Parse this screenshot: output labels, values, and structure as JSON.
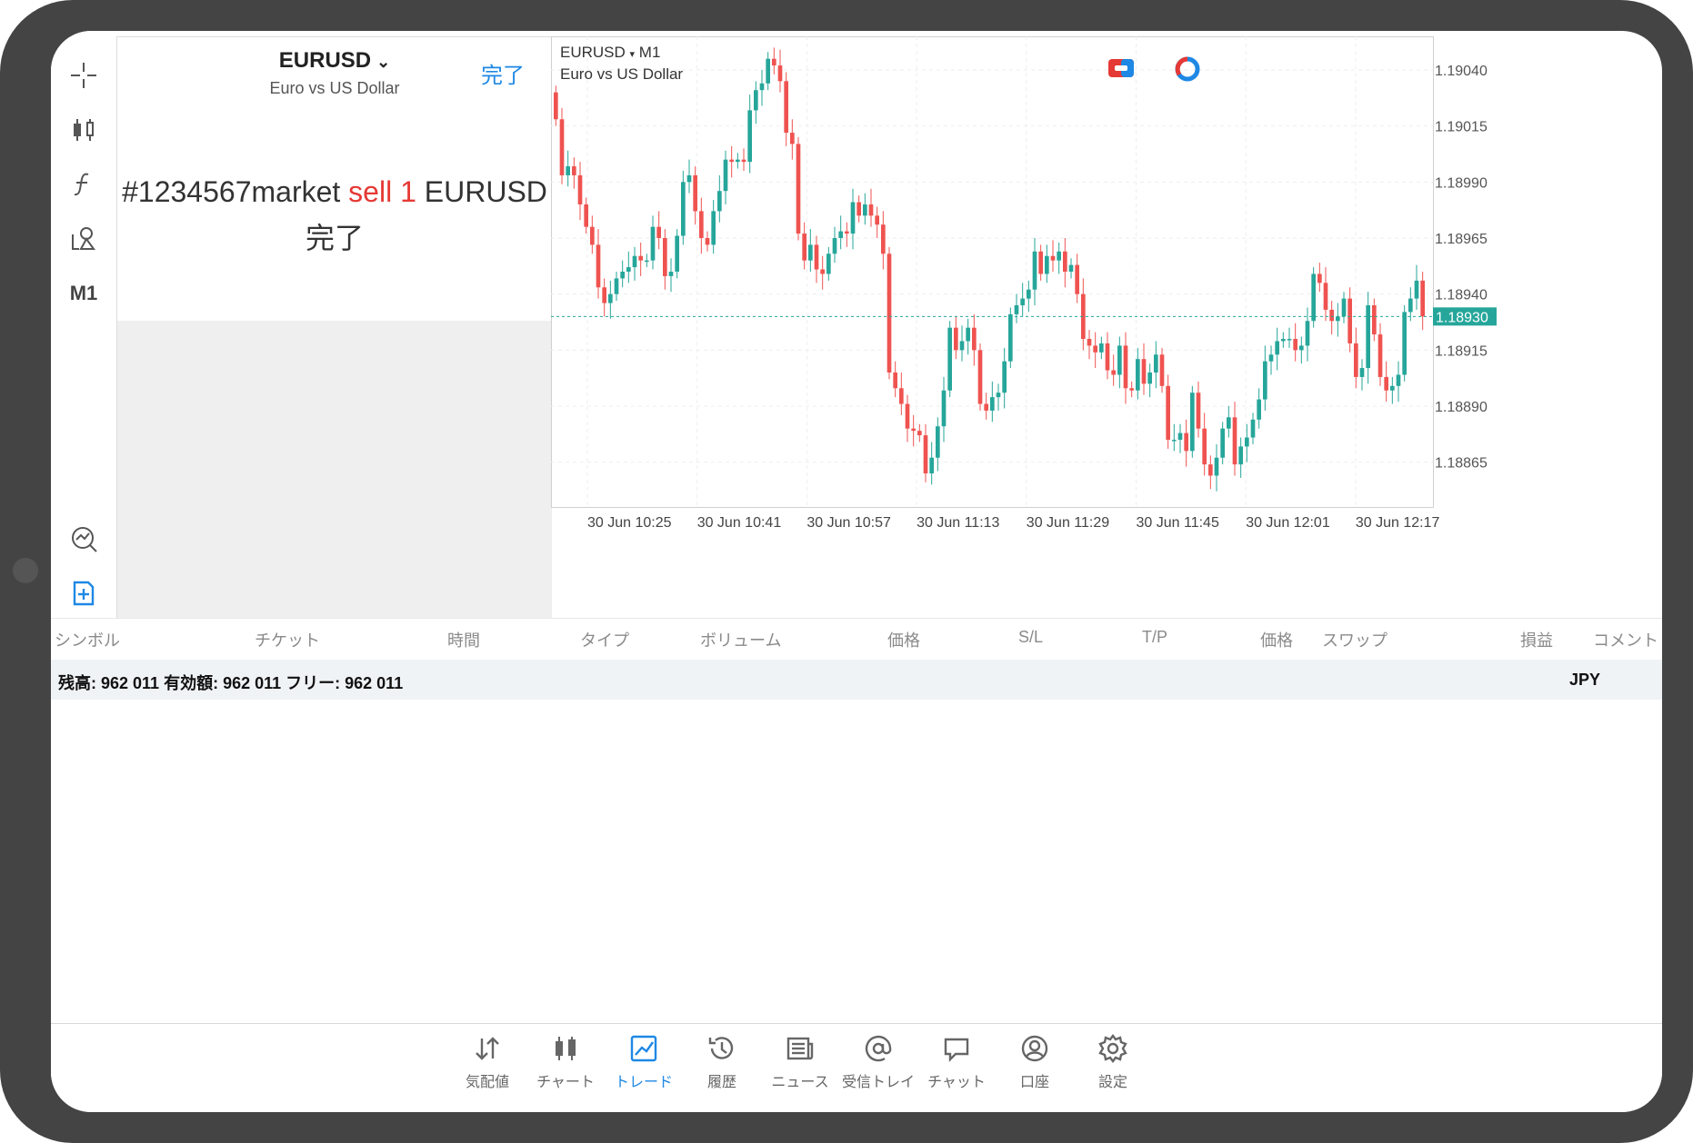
{
  "order": {
    "symbol": "EURUSD",
    "description": "Euro vs US Dollar",
    "done_label": "完了",
    "message_prefix": "#1234567market ",
    "message_action": "sell 1",
    "message_symbol": " EURUSD",
    "status": "完了"
  },
  "toolbar": {
    "icons": [
      "crosshair-icon",
      "candlestick-icon",
      "function-icon",
      "objects-icon",
      "timeframe",
      "indicator-icon",
      "new-order-icon"
    ],
    "timeframe": "M1"
  },
  "chart": {
    "symbol_title": "EURUSD",
    "timeframe": "M1",
    "description": "Euro vs US Dollar",
    "bid_price_label": "1.18930",
    "colors": {
      "bull": "#26a69a",
      "bear": "#ef5350",
      "grid": "#eeeeee",
      "bid_line": "#26a69a"
    }
  },
  "chart_data": {
    "type": "candlestick",
    "y_ticks": [
      "1.19040",
      "1.19015",
      "1.18990",
      "1.18965",
      "1.18940",
      "1.18915",
      "1.18890",
      "1.18865"
    ],
    "x_ticks": [
      "30 Jun 10:25",
      "30 Jun 10:41",
      "30 Jun 10:57",
      "30 Jun 11:13",
      "30 Jun 11:29",
      "30 Jun 11:45",
      "30 Jun 12:01",
      "30 Jun 12:17"
    ],
    "ylim": [
      1.18845,
      1.19055
    ],
    "bid": 1.1893,
    "closes": [
      1.19018,
      1.18993,
      1.18997,
      1.18993,
      1.1898,
      1.1897,
      1.18962,
      1.18943,
      1.18936,
      1.1894,
      1.18947,
      1.1895,
      1.18952,
      1.18957,
      1.18955,
      1.18955,
      1.1897,
      1.18965,
      1.18948,
      1.1895,
      1.18966,
      1.1899,
      1.18993,
      1.18977,
      1.18965,
      1.18962,
      1.18977,
      1.18986,
      1.19,
      1.18999,
      1.19,
      1.18999,
      1.19022,
      1.19031,
      1.19034,
      1.19045,
      1.19042,
      1.19035,
      1.19012,
      1.19007,
      1.18967,
      1.18955,
      1.18962,
      1.18951,
      1.18949,
      1.18958,
      1.18965,
      1.18968,
      1.18967,
      1.18981,
      1.18975,
      1.1898,
      1.18975,
      1.18971,
      1.18958,
      1.18905,
      1.18898,
      1.18891,
      1.1888,
      1.18879,
      1.18877,
      1.1886,
      1.18867,
      1.18881,
      1.18897,
      1.18925,
      1.18915,
      1.18919,
      1.18925,
      1.18915,
      1.18891,
      1.18888,
      1.18894,
      1.18896,
      1.1891,
      1.18931,
      1.18935,
      1.18938,
      1.18942,
      1.18959,
      1.18949,
      1.18957,
      1.18955,
      1.18959,
      1.1895,
      1.18953,
      1.1894,
      1.1892,
      1.18917,
      1.18914,
      1.18918,
      1.18906,
      1.18904,
      1.18917,
      1.18898,
      1.18897,
      1.18911,
      1.189,
      1.18905,
      1.18913,
      1.18899,
      1.18875,
      1.18875,
      1.18878,
      1.1887,
      1.18896,
      1.1888,
      1.18864,
      1.18859,
      1.18867,
      1.1888,
      1.18885,
      1.18864,
      1.18872,
      1.18876,
      1.18884,
      1.18893,
      1.1891,
      1.18913,
      1.18919,
      1.1892,
      1.1892,
      1.18915,
      1.18917,
      1.18928,
      1.18949,
      1.18945,
      1.18933,
      1.18928,
      1.1893,
      1.18938,
      1.18918,
      1.18903,
      1.18907,
      1.18935,
      1.18922,
      1.18903,
      1.18897,
      1.18899,
      1.18904,
      1.18932,
      1.18938,
      1.18946,
      1.1893
    ]
  },
  "table": {
    "headers": [
      "シンボル",
      "チケット",
      "時間",
      "タイプ",
      "ボリューム",
      "価格",
      "S/L",
      "T/P",
      "価格",
      "スワップ",
      "損益",
      "コメント"
    ],
    "balance_text": "残高: 962 011 有効額: 962 011 フリー: 962 011",
    "currency": "JPY"
  },
  "tabs": [
    {
      "label": "気配値",
      "icon": "quotes-icon"
    },
    {
      "label": "チャート",
      "icon": "chart-icon"
    },
    {
      "label": "トレード",
      "icon": "trade-icon",
      "active": true
    },
    {
      "label": "履歴",
      "icon": "history-icon"
    },
    {
      "label": "ニュース",
      "icon": "news-icon"
    },
    {
      "label": "受信トレイ",
      "icon": "mail-icon"
    },
    {
      "label": "チャット",
      "icon": "chat-icon"
    },
    {
      "label": "口座",
      "icon": "account-icon"
    },
    {
      "label": "設定",
      "icon": "settings-icon"
    }
  ]
}
